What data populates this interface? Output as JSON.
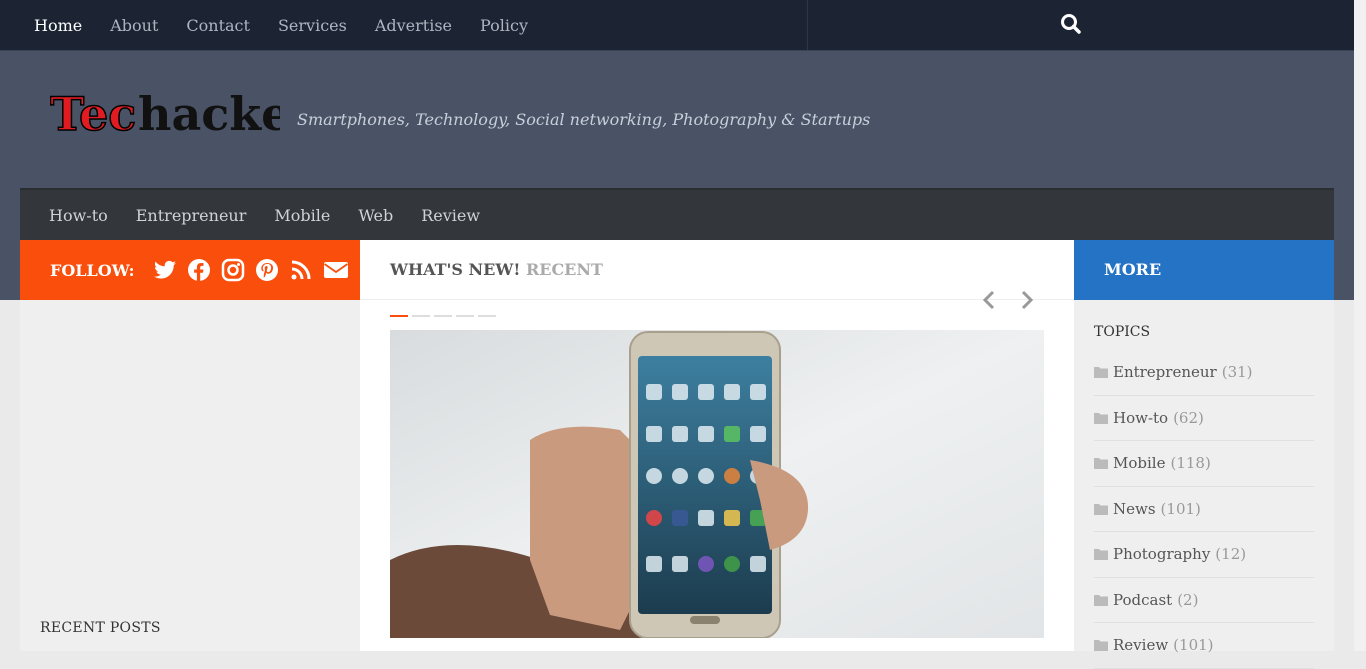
{
  "topnav": {
    "items": [
      {
        "label": "Home",
        "active": true
      },
      {
        "label": "About"
      },
      {
        "label": "Contact"
      },
      {
        "label": "Services"
      },
      {
        "label": "Advertise"
      },
      {
        "label": "Policy"
      }
    ]
  },
  "search_icon": "search-icon",
  "header": {
    "logo_text": "Techacker",
    "tagline": "Smartphones, Technology, Social networking, Photography & Startups"
  },
  "mainnav": {
    "items": [
      "How-to",
      "Entrepreneur",
      "Mobile",
      "Web",
      "Review"
    ]
  },
  "follow": {
    "label": "FOLLOW:",
    "icons": [
      "twitter-icon",
      "facebook-icon",
      "instagram-icon",
      "pinterest-icon",
      "rss-icon",
      "email-icon"
    ]
  },
  "content": {
    "title": "WHAT'S NEW!",
    "subtitle": "RECENT",
    "slider_active": 1,
    "slider_count": 5
  },
  "sidebar_left": {
    "recent_title": "RECENT POSTS"
  },
  "sidebar_right": {
    "header": "MORE",
    "topics_title": "TOPICS",
    "topics": [
      {
        "name": "Entrepreneur",
        "count": "(31)"
      },
      {
        "name": "How-to",
        "count": "(62)"
      },
      {
        "name": "Mobile",
        "count": "(118)"
      },
      {
        "name": "News",
        "count": "(101)"
      },
      {
        "name": "Photography",
        "count": "(12)"
      },
      {
        "name": "Podcast",
        "count": "(2)"
      },
      {
        "name": "Review",
        "count": "(101)"
      }
    ]
  },
  "colors": {
    "topbar": "#1c2434",
    "header": "#4a5366",
    "follow": "#fa4e0d",
    "more": "#2473c4",
    "mainnav": "#33363b"
  }
}
